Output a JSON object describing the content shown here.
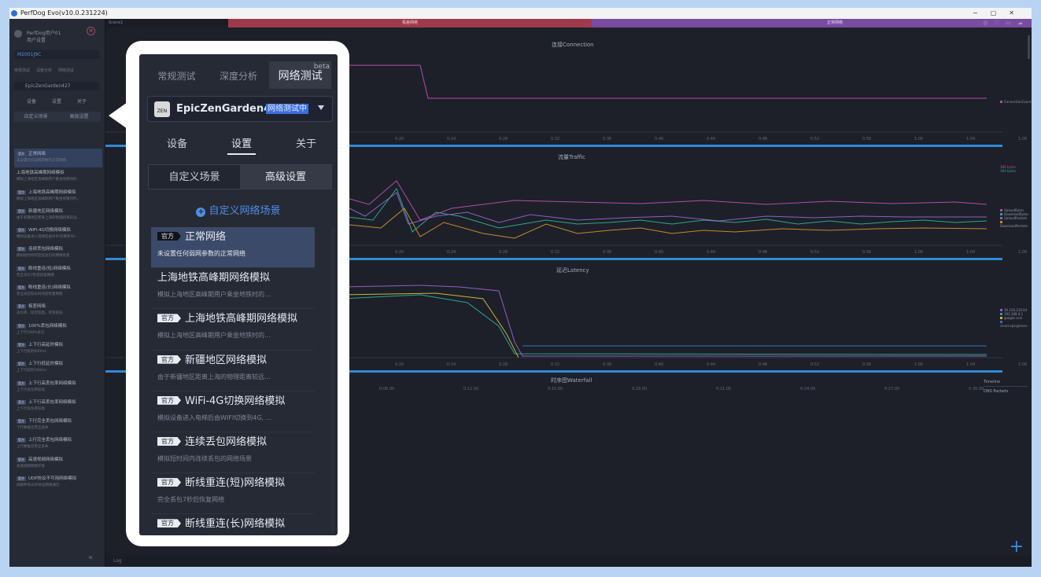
{
  "window": {
    "title": "PerfDog Evo(v10.0.231224)"
  },
  "sidebar": {
    "user_name": "PerfDog用户01",
    "user_sub": "用户设置",
    "device": "M2001J9C",
    "top_tabs": [
      "常规测试",
      "深度分析",
      "网络测试"
    ],
    "app": "EpicZenGarden427",
    "sub_tabs": [
      "设备",
      "设置",
      "关于"
    ],
    "scene_tabs": [
      "自定义场景",
      "高级设置"
    ],
    "items": [
      {
        "name": "正常网络",
        "desc": "未设置任何弱网参数的正常网络"
      },
      {
        "name": "上海地铁高峰期网络模拟",
        "desc": "模拟上海地区高峰期用户乘坐地铁时的..."
      },
      {
        "name": "上海地铁高峰期网络模拟",
        "desc": "模拟上海地区高峰期用户乘坐地铁时的..."
      },
      {
        "name": "新疆地区网络模拟",
        "desc": "由于新疆地区距离上海的物理距离较远..."
      },
      {
        "name": "WiFi-4G切换网络模拟",
        "desc": "模拟设备进入电梯后由WIFI切换到4G..."
      },
      {
        "name": "连续丢包网络模拟",
        "desc": "模拟短时间内连续丢包的网络场景"
      },
      {
        "name": "断线重连(短)网络模拟",
        "desc": "完全丢包7秒后恢复网络"
      },
      {
        "name": "断线重连(长)网络模拟",
        "desc": "完全丢包较长时间后恢复网络"
      },
      {
        "name": "极差网络",
        "desc": "丢包率、延迟较高、带宽很低"
      },
      {
        "name": "100%丢包网络模拟",
        "desc": "上下行100%丢包"
      },
      {
        "name": "上下行高延时模拟",
        "desc": "上下行延时600ms"
      },
      {
        "name": "上下行低延时模拟",
        "desc": "上下行延时100ms"
      },
      {
        "name": "上下行高丢包率网络模拟",
        "desc": "上下行丢包率较高"
      },
      {
        "name": "上下行高丢包率网络模拟",
        "desc": "上下行丢包率较高"
      },
      {
        "name": "下行完全丢包网络模拟",
        "desc": "下行数据包完全丢失"
      },
      {
        "name": "上行完全丢包网络模拟",
        "desc": "上行数据包完全丢失"
      },
      {
        "name": "高速视频网络模拟",
        "desc": "高速视频网络环境"
      },
      {
        "name": "UDP协议不可用网络模拟",
        "desc": "屏蔽所有UDP协议网络通信"
      }
    ],
    "tag": "官方"
  },
  "topbar": {
    "left": "Scene1",
    "red_label": "极差网络",
    "purple_label": "正常网络",
    "icons": "◎ ♡ ▭ ☁"
  },
  "charts": {
    "connection": {
      "title": "连接Connection",
      "legend": [
        "ConnectionCount"
      ]
    },
    "traffic": {
      "title": "流量Traffic",
      "legend": [
        "UploadBytes",
        "DownloadBytes",
        "UploadPackets",
        "DownloadPackets"
      ],
      "top_legend": [
        "384 bytes",
        "384 bytes"
      ]
    },
    "latency": {
      "title": "延迟Latency",
      "legend": [
        "39.156.216.64",
        "192.168.0.1",
        "google.com",
        "cloud.epicgames..."
      ]
    },
    "waterfall": {
      "title": "时序图Waterfall",
      "ticks": [
        "0:06.00",
        "0:12.00",
        "0:15.00",
        "0:18.00",
        "0:21.00",
        "0:24.00",
        "0:27.00",
        "0:30.00"
      ]
    },
    "ticks": [
      "0:20",
      "0:24",
      "0:28",
      "0:32",
      "0:36",
      "0:40",
      "0:44",
      "0:48",
      "0:52",
      "0:56",
      "1:00",
      "1:04",
      "1:06"
    ]
  },
  "timeline": {
    "label": "Timeline",
    "item": "DNS Packets"
  },
  "bottom": {
    "log": "Log"
  },
  "panel": {
    "tabs": [
      "常规测试",
      "深度分析",
      "网络测试"
    ],
    "beta": "beta",
    "app_name": "EpicZenGarden427",
    "app_badge": "网络测试中",
    "app_icon_text": "ZEN",
    "subtabs": [
      "设备",
      "设置",
      "关于"
    ],
    "scene_tabs": [
      "自定义场景",
      "高级设置"
    ],
    "add_label": "自定义网络场景",
    "tag": "官方",
    "items": [
      {
        "name": "正常网络",
        "desc": "未设置任何弱网参数的正常网络",
        "tagged": true
      },
      {
        "name": "上海地铁高峰期网络模拟",
        "desc": "模拟上海地区高峰期用户乘坐地铁时的...",
        "tagged": false
      },
      {
        "name": "上海地铁高峰期网络模拟",
        "desc": "模拟上海地区高峰期用户乘坐地铁时的...",
        "tagged": true
      },
      {
        "name": "新疆地区网络模拟",
        "desc": "由于新疆地区距离上海的物理距离较远...",
        "tagged": true
      },
      {
        "name": "WiFi-4G切换网络模拟",
        "desc": "模拟设备进入电梯后由WIFI切换到4G, ...",
        "tagged": true
      },
      {
        "name": "连续丢包网络模拟",
        "desc": "模拟短时间内连续丢包的网络场景",
        "tagged": true
      },
      {
        "name": "断线重连(短)网络模拟",
        "desc": "完全丢包7秒后恢复网络",
        "tagged": true
      },
      {
        "name": "断线重连(长)网络模拟",
        "desc": "",
        "tagged": true
      }
    ]
  },
  "colors": {
    "accent": "#3b8ae0",
    "active_item": "#3b4a68",
    "panel_bg": "#262a34"
  }
}
